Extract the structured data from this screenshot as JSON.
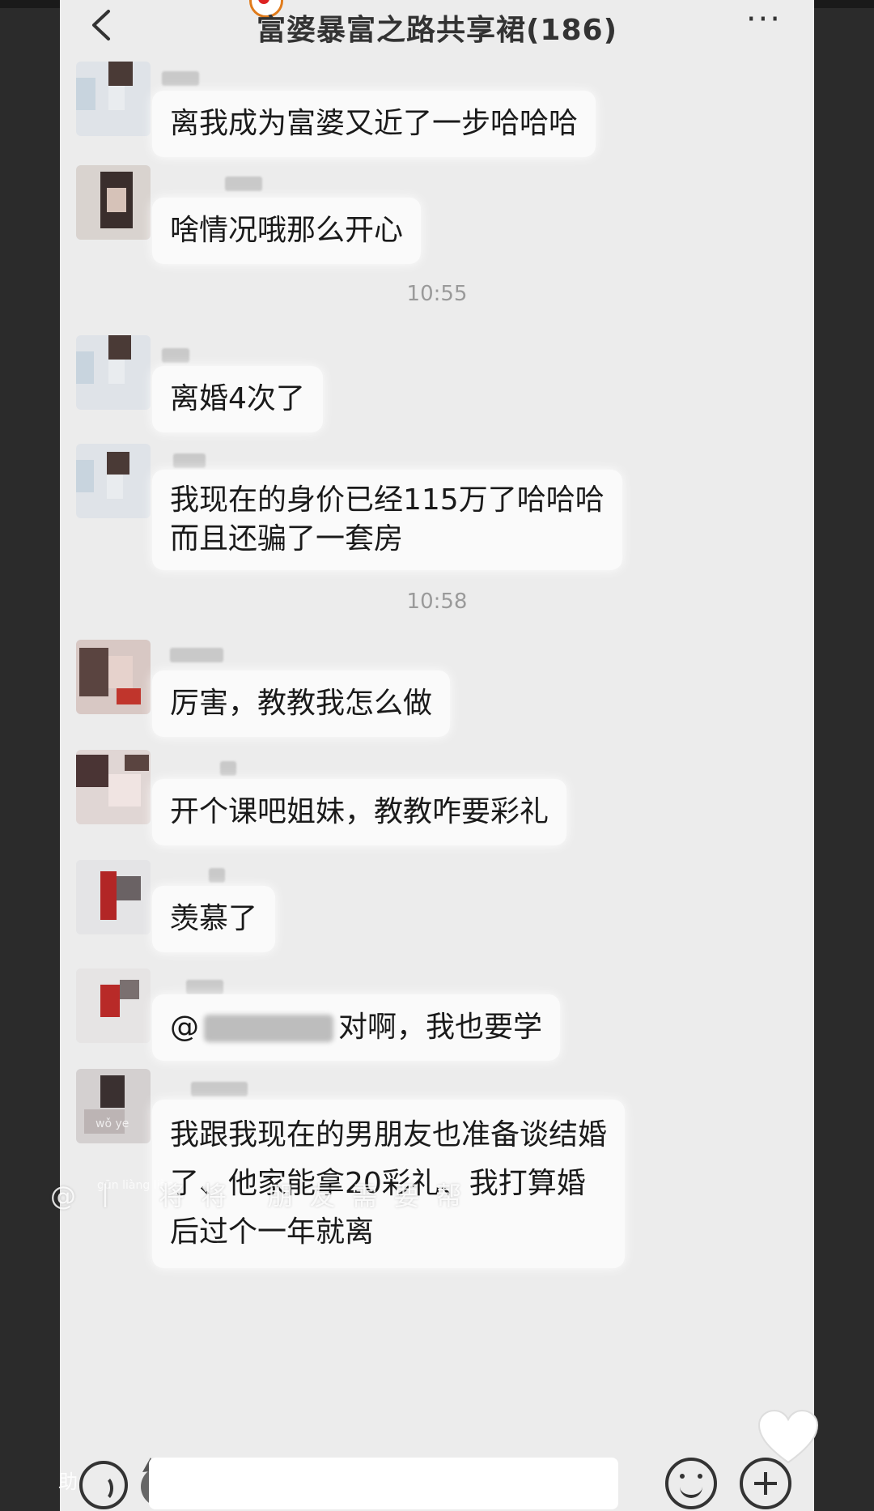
{
  "header": {
    "title": "富婆暴富之路共享裙(186)",
    "more_label": "···"
  },
  "messages": [
    {
      "text": "离我成为富婆又近了一步哈哈哈"
    },
    {
      "text": "啥情况哦那么开心"
    },
    {
      "time": "10:55"
    },
    {
      "text": "离婚4次了"
    },
    {
      "lines": [
        "我现在的身价已经115万了哈哈哈",
        "而且还骗了一套房"
      ]
    },
    {
      "time": "10:58"
    },
    {
      "text": "厉害，教教我怎么做"
    },
    {
      "text": "开个课吧姐妹，教教咋要彩礼"
    },
    {
      "text": "羡慕了"
    },
    {
      "prefix": "@",
      "suffix": "对啊，我也要学"
    },
    {
      "lines": [
        "我跟我现在的男朋友也准备谈结婚",
        "了、他家能拿20彩礼、我打算婚",
        "后过个一年就离"
      ]
    }
  ],
  "overlay": {
    "caption": "@丨 将将 朋友需要帮",
    "pinyin_left": "wǒ    ye",
    "pinyin_mid": "gūn  liàng  liàng",
    "side_mark": "助"
  },
  "colors": {
    "bg": "#ececec",
    "bubble": "#fafafa",
    "time": "#9a9a9a"
  }
}
